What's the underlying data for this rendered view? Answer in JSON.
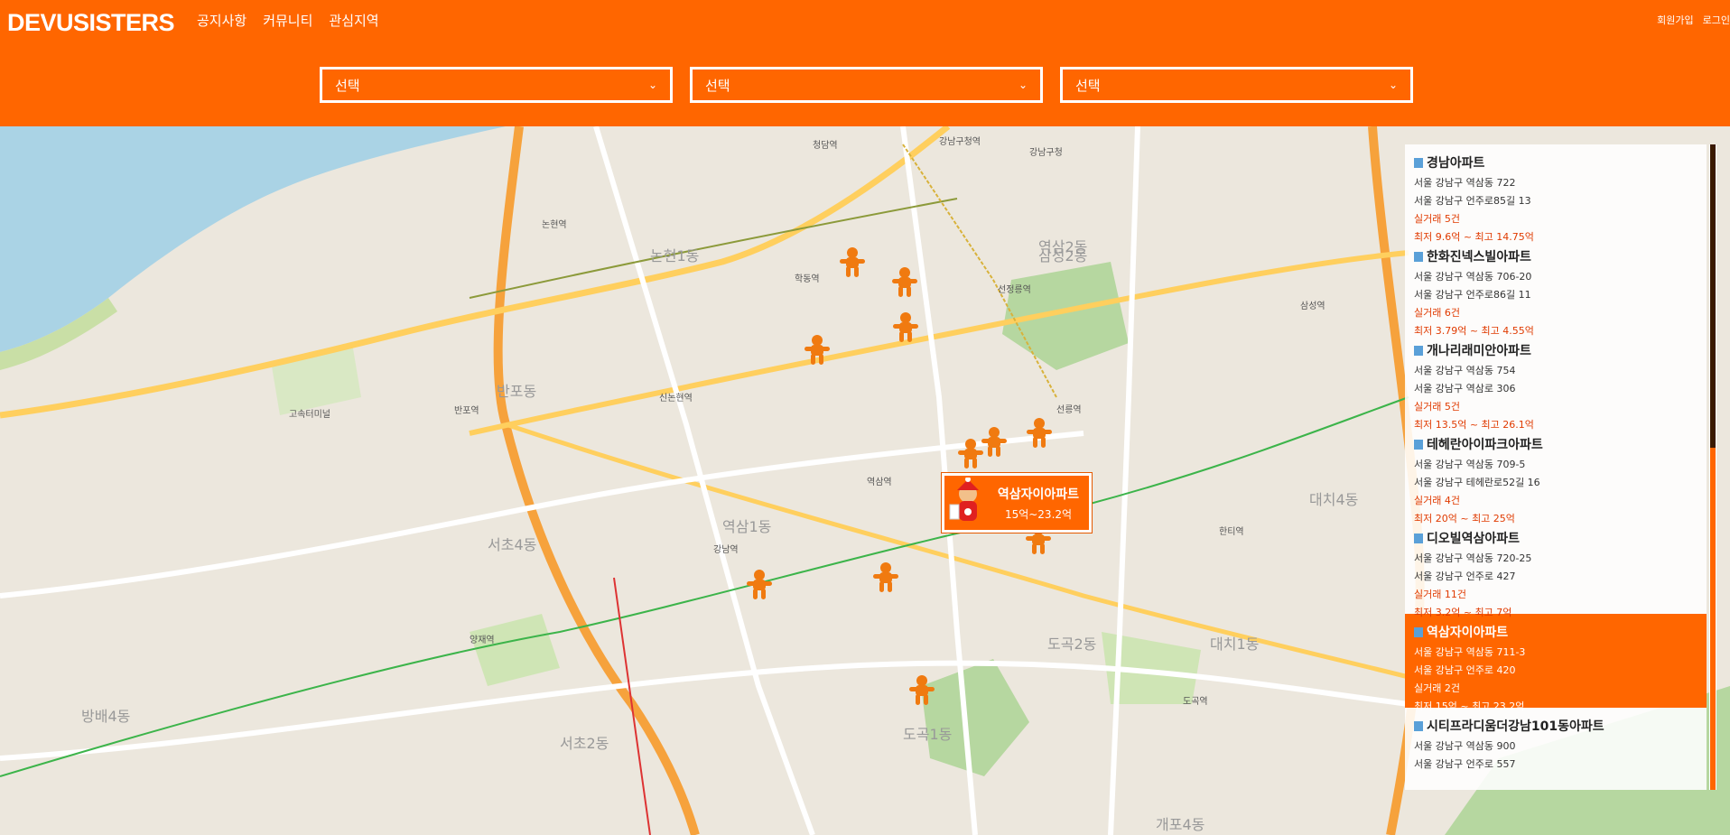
{
  "header": {
    "logo": "DEVUSISTERS",
    "nav": [
      "공지사항",
      "커뮤니티",
      "관심지역"
    ],
    "signup": "회원가입",
    "login": "로그인",
    "selects": [
      "선택",
      "선택",
      "선택"
    ]
  },
  "popup": {
    "name": "역삼자이아파트",
    "price": "15억~23.2억"
  },
  "map_labels": [
    "강남구청역",
    "선정릉역",
    "논현역",
    "학동역",
    "신논현역",
    "강남역",
    "역삼역",
    "선릉역",
    "도곡역",
    "반포역",
    "고속터미널",
    "양재역",
    "한티역",
    "삼성역",
    "청담역",
    "강남구청",
    "반포동",
    "논현1동",
    "역삼1동",
    "역삼2동",
    "대치1동",
    "대치4동",
    "도곡1동",
    "도곡2동",
    "서초4동",
    "방배4동",
    "삼성2동",
    "개포4동",
    "서초2동"
  ],
  "apartments": [
    {
      "name": "경남아파트",
      "addr1": "서울 강남구 역삼동 722",
      "addr2": "서울 강남구 언주로85길 13",
      "deals": "실거래 5건",
      "range": "최저 9.6억 ~ 최고 14.75억",
      "active": false
    },
    {
      "name": "한화진넥스빌아파트",
      "addr1": "서울 강남구 역삼동 706-20",
      "addr2": "서울 강남구 언주로86길 11",
      "deals": "실거래 6건",
      "range": "최저 3.79억 ~ 최고 4.55억",
      "active": false
    },
    {
      "name": "개나리래미안아파트",
      "addr1": "서울 강남구 역삼동 754",
      "addr2": "서울 강남구 역삼로 306",
      "deals": "실거래 5건",
      "range": "최저 13.5억 ~ 최고 26.1억",
      "active": false
    },
    {
      "name": "테헤란아이파크아파트",
      "addr1": "서울 강남구 역삼동 709-5",
      "addr2": "서울 강남구 테헤란로52길 16",
      "deals": "실거래 4건",
      "range": "최저 20억 ~ 최고 25억",
      "active": false
    },
    {
      "name": "디오빌역삼아파트",
      "addr1": "서울 강남구 역삼동 720-25",
      "addr2": "서울 강남구 언주로 427",
      "deals": "실거래 11건",
      "range": "최저 3.2억 ~ 최고 7억",
      "active": false
    },
    {
      "name": "역삼자이아파트",
      "addr1": "서울 강남구 역삼동 711-3",
      "addr2": "서울 강남구 언주로 420",
      "deals": "실거래 2건",
      "range": "최저 15억 ~ 최고 23.2억",
      "active": true
    },
    {
      "name": "시티프라디움더강남101동아파트",
      "addr1": "서울 강남구 역삼동 900",
      "addr2": "서울 강남구 언주로 557",
      "deals": "",
      "range": "",
      "active": false
    }
  ],
  "colors": {
    "brand": "#ff6600",
    "price_text": "#e03a00"
  },
  "icons": {
    "marker": "gingerbread-icon",
    "building": "building-icon",
    "dropdown": "chevron-down-icon"
  }
}
